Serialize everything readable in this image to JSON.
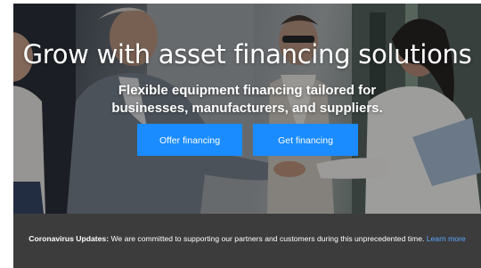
{
  "hero": {
    "headline": "Grow with asset financing solutions",
    "subhead": "Flexible equipment financing tailored for businesses, manufacturers, and suppliers.",
    "buttons": {
      "offer_financing": "Offer financing",
      "get_financing": "Get financing"
    }
  },
  "banner": {
    "label": "Coronavirus Updates:",
    "message": " We are committed to supporting our partners and customers during this unprecedented time. ",
    "link_text": "Learn more"
  },
  "colors": {
    "button": "#1a8cff",
    "banner_background": "#3c3c3c",
    "link": "#5aa7ff"
  }
}
